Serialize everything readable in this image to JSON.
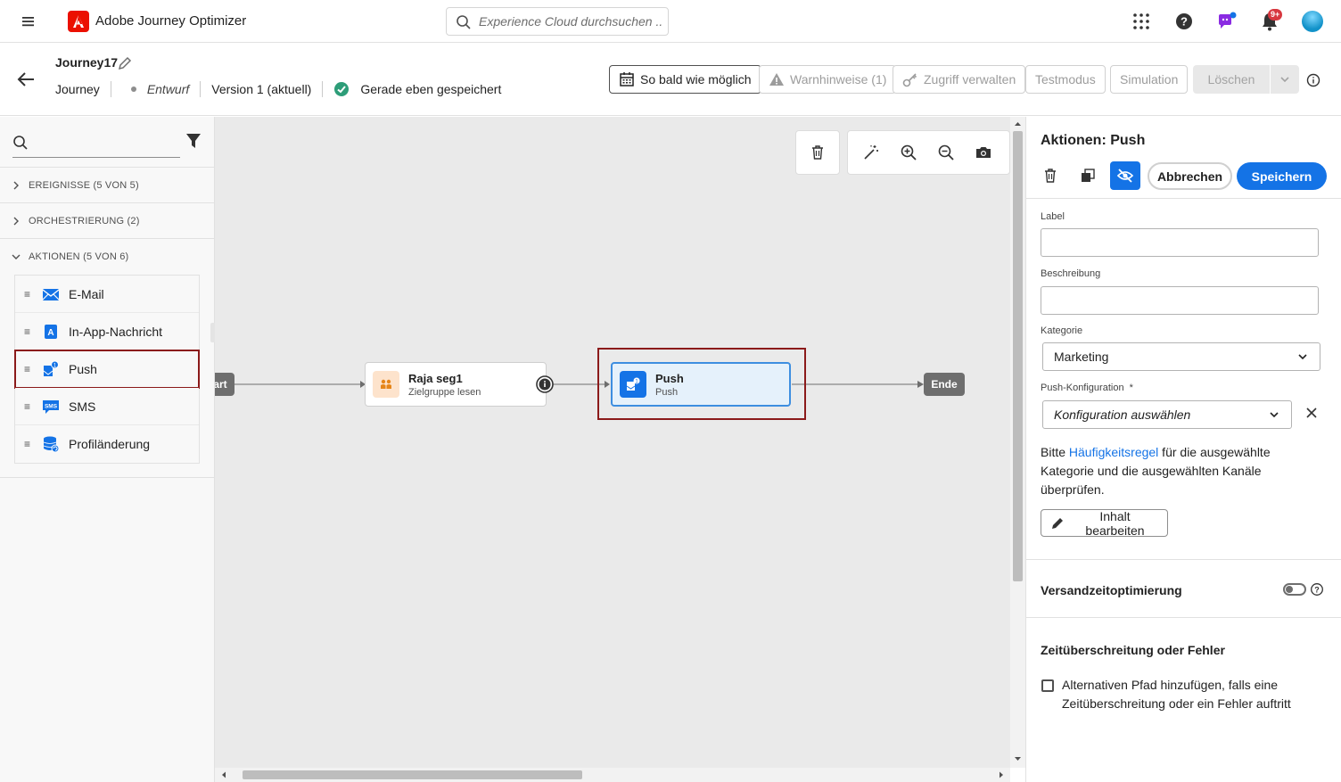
{
  "app": {
    "title": "Adobe Journey Optimizer",
    "search_placeholder": "Experience Cloud durchsuchen ...",
    "notification_count": "9+"
  },
  "journey": {
    "name": "Journey17",
    "type": "Journey",
    "status": "Entwurf",
    "version": "Version 1 (aktuell)",
    "save_status": "Gerade eben gespeichert"
  },
  "header_buttons": {
    "schedule": "So bald wie möglich",
    "warnings": "Warnhinweise (1)",
    "access": "Zugriff verwalten",
    "test_mode": "Testmodus",
    "simulation": "Simulation",
    "delete": "Löschen"
  },
  "palette": {
    "sections": {
      "events": "EREIGNISSE (5 VON 5)",
      "orchestration": "ORCHESTRIERUNG (2)",
      "actions": "AKTIONEN (5 VON 6)"
    },
    "actions": [
      {
        "label": "E-Mail",
        "icon": "email-icon"
      },
      {
        "label": "In-App-Nachricht",
        "icon": "in-app-icon"
      },
      {
        "label": "Push",
        "icon": "push-icon"
      },
      {
        "label": "SMS",
        "icon": "sms-icon"
      },
      {
        "label": "Profiländerung",
        "icon": "profile-update-icon"
      }
    ]
  },
  "canvas": {
    "start_label": "art",
    "node_segment": {
      "title": "Raja seg1",
      "subtitle": "Zielgruppe lesen"
    },
    "node_push": {
      "title": "Push",
      "subtitle": "Push"
    },
    "end_label": "Ende"
  },
  "panel": {
    "title": "Aktionen: Push",
    "cancel": "Abbrechen",
    "save": "Speichern",
    "label_label": "Label",
    "label_value": "",
    "description_label": "Beschreibung",
    "description_value": "",
    "category_label": "Kategorie",
    "category_value": "Marketing",
    "push_config_label": "Push-Konfiguration",
    "required_mark": "*",
    "push_config_value": "Konfiguration auswählen",
    "info_prefix": "Bitte ",
    "info_link": "Häufigkeitsregel",
    "info_suffix": " für die ausgewählte Kategorie und die ausgewählten Kanäle überprüfen.",
    "edit_content": "Inhalt bearbeiten",
    "send_time_optimization": "Versandzeitoptimierung",
    "timeout_heading": "Zeitüberschreitung oder Fehler",
    "alt_path_label": "Alternativen Pfad hinzufügen, falls eine Zeitüberschreitung oder ein Fehler auftritt"
  },
  "colors": {
    "accent": "#1473e6",
    "highlight": "#8b1a1a",
    "adobe_red": "#eb1000"
  }
}
